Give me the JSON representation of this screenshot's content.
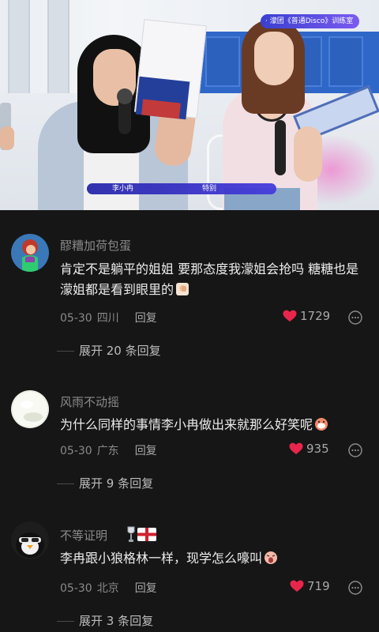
{
  "video": {
    "show_tag": "· 濛团《普通Disco》训练室",
    "name_label": "李小冉",
    "tag_label": "特别"
  },
  "comments": [
    {
      "username": "醪糟加荷包蛋",
      "content": "肯定不是躺平的姐姐 要那态度我濛姐会抢吗 糖糖也是 濛姐都是看到眼里的",
      "date": "05-30",
      "location": "四川",
      "reply_label": "回复",
      "likes": "1729",
      "expand_label": "展开 20 条回复",
      "avatar_icon": "mermaid-avatar"
    },
    {
      "username": "风雨不动摇",
      "content": "为什么同样的事情李小冉做出来就那么好笑呢",
      "date": "05-30",
      "location": "广东",
      "reply_label": "回复",
      "likes": "935",
      "expand_label": "展开 9 条回复",
      "avatar_icon": "white-ball-avatar"
    },
    {
      "username": "不等证明",
      "content": "李冉跟小狼格林一样，现学怎么嚎叫",
      "date": "05-30",
      "location": "北京",
      "reply_label": "回复",
      "likes": "719",
      "expand_label": "展开 3 条回复",
      "avatar_icon": "penguin-avatar",
      "badge_icon": "england-flag-trophy-badge"
    }
  ],
  "colors": {
    "background": "#161616",
    "heart": "#e8264b",
    "username": "#8a8a8a",
    "content": "#ececec"
  }
}
